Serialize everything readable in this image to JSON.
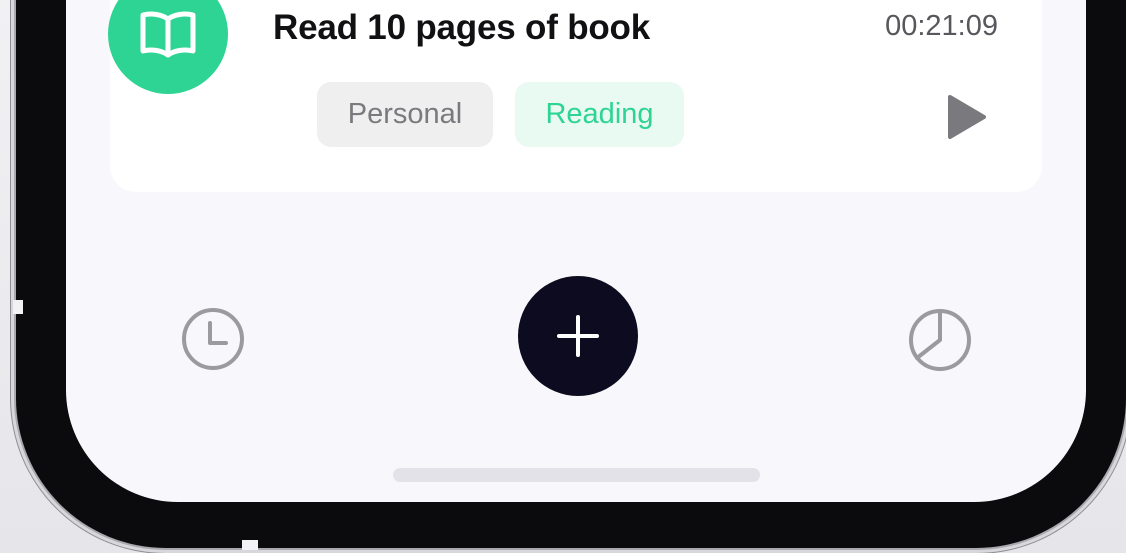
{
  "task": {
    "title": "Read 10 pages of book",
    "timer": "00:21:09",
    "icon": "book-icon",
    "tags": [
      "Personal",
      "Reading"
    ],
    "play_icon": "play-icon"
  },
  "nav": {
    "left_icon": "clock-icon",
    "center_icon": "plus-icon",
    "right_icon": "pie-chart-icon"
  },
  "colors": {
    "accent_green": "#2ed493",
    "tag_reading_bg": "#e8faf2",
    "tag_personal_bg": "#efefef",
    "fab_bg": "#0d0b1f",
    "screen_bg": "#f8f7fb"
  }
}
